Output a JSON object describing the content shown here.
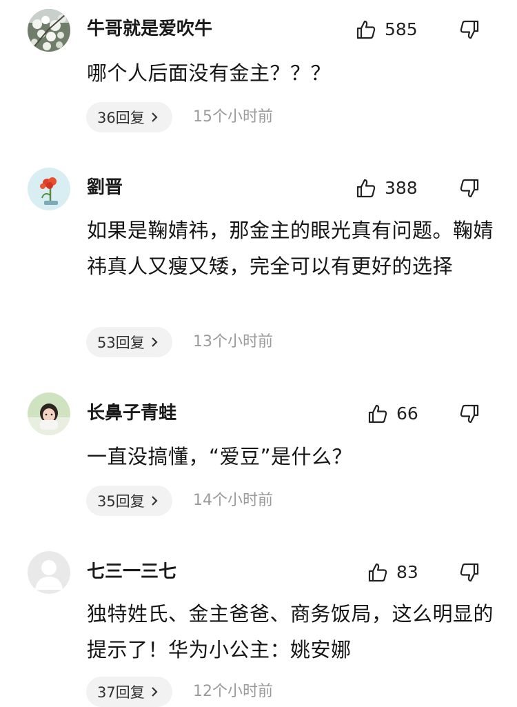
{
  "comments": [
    {
      "username": "牛哥就是爱吹牛",
      "likes": "585",
      "text": "哪个人后面没有金主？？？",
      "reply_label": "36回复",
      "time": "15个小时前",
      "avatar": "white-blossom-avatar"
    },
    {
      "username": "劉晋",
      "likes": "388",
      "text": "如果是鞠婧祎，那金主的眼光真有问题。鞠婧祎真人又瘦又矮，完全可以有更好的选择",
      "reply_label": "53回复",
      "time": "13个小时前",
      "avatar": "red-flower-avatar"
    },
    {
      "username": "长鼻子青蛙",
      "likes": "66",
      "text": "一直没搞懂，“爱豆”是什么？",
      "reply_label": "35回复",
      "time": "14个小时前",
      "avatar": "girl-photo-avatar"
    },
    {
      "username": "七三一三七",
      "likes": "83",
      "text": "独特姓氏、金主爸爸、商务饭局，这么明显的提示了！华为小公主：姚安娜",
      "reply_label": "37回复",
      "time": "12个小时前",
      "avatar": "default-user-avatar"
    }
  ]
}
